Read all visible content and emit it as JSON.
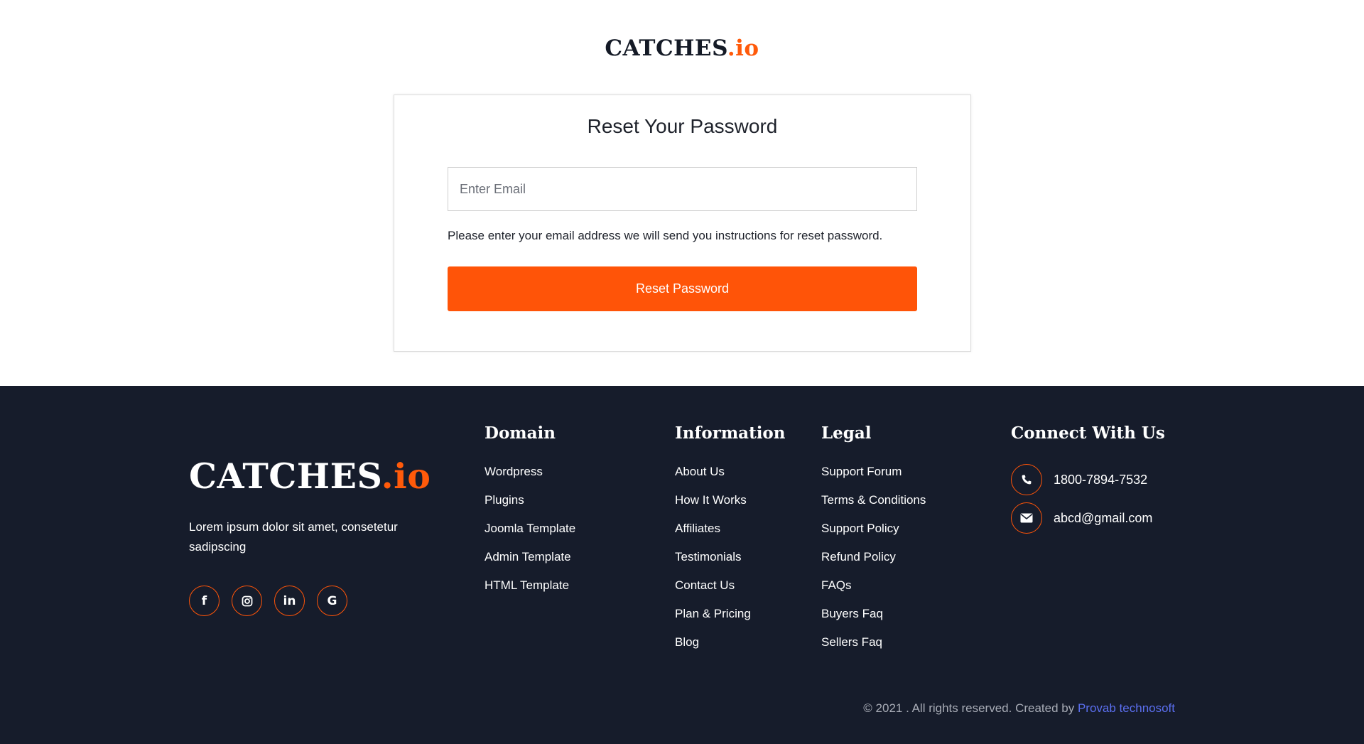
{
  "brand": {
    "name": "CATCHES",
    "suffix": ".io"
  },
  "reset_form": {
    "title": "Reset Your Password",
    "email_placeholder": "Enter Email",
    "help_text": "Please enter your email address we will send you instructions for reset password.",
    "button_label": "Reset Password"
  },
  "footer": {
    "description": "Lorem ipsum dolor sit amet, consetetur sadipscing",
    "socials": [
      {
        "name": "facebook-icon",
        "glyph": "f"
      },
      {
        "name": "instagram-icon",
        "glyph": ""
      },
      {
        "name": "linkedin-icon",
        "glyph": "in"
      },
      {
        "name": "google-icon",
        "glyph": "G"
      }
    ],
    "domain": {
      "title": "Domain",
      "links": [
        "Wordpress",
        "Plugins",
        "Joomla Template",
        "Admin Template",
        "HTML Template"
      ]
    },
    "information": {
      "title": "Information",
      "links": [
        "About Us",
        "How It Works",
        "Affiliates",
        "Testimonials",
        "Contact Us",
        "Plan & Pricing",
        "Blog"
      ]
    },
    "legal": {
      "title": "Legal",
      "links": [
        "Support Forum",
        "Terms & Conditions",
        "Support Policy",
        "Refund Policy",
        "FAQs",
        "Buyers Faq",
        "Sellers Faq"
      ]
    },
    "connect": {
      "title": "Connect With Us",
      "phone": "1800-7894-7532",
      "email": "abcd@gmail.com"
    },
    "copyright": {
      "text": "© 2021 . All rights reserved. Created by ",
      "credit": "Provab technosoft"
    }
  },
  "colors": {
    "accent": "#ff5408",
    "footer_bg": "#161c2b",
    "credit_link": "#5b6ff0"
  }
}
